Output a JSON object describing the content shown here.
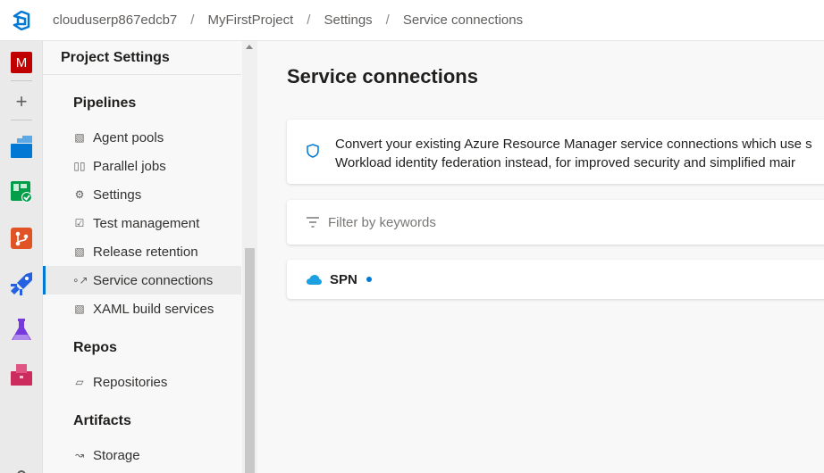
{
  "breadcrumb": [
    "clouduserp867edcb7",
    "MyFirstProject",
    "Settings",
    "Service connections"
  ],
  "rail": {
    "avatar_letter": "M"
  },
  "sidebar": {
    "title": "Project Settings",
    "groups": {
      "pipelines": "Pipelines",
      "repos": "Repos",
      "artifacts": "Artifacts"
    },
    "items": [
      {
        "label": "Agent pools",
        "icon": "agent-pool-icon"
      },
      {
        "label": "Parallel jobs",
        "icon": "parallel-jobs-icon"
      },
      {
        "label": "Settings",
        "icon": "gear-icon"
      },
      {
        "label": "Test management",
        "icon": "test-management-icon"
      },
      {
        "label": "Release retention",
        "icon": "release-retention-icon"
      },
      {
        "label": "Service connections",
        "icon": "service-connections-icon",
        "active": true
      },
      {
        "label": "XAML build services",
        "icon": "xaml-build-icon"
      },
      {
        "label": "Repositories",
        "icon": "repositories-icon"
      },
      {
        "label": "Storage",
        "icon": "storage-icon"
      }
    ]
  },
  "main": {
    "title": "Service connections",
    "info_line1": "Convert your existing Azure Resource Manager service connections which use s",
    "info_line2": "Workload identity federation instead, for improved security and simplified mair",
    "filter_placeholder": "Filter by keywords",
    "connections": [
      {
        "name": "SPN"
      }
    ]
  },
  "colors": {
    "accent": "#0078d4",
    "avatar": "#c00000"
  }
}
